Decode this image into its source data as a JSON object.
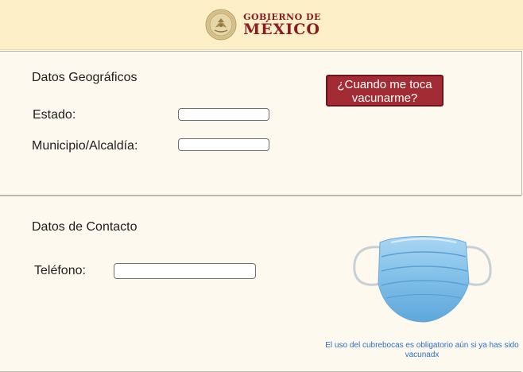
{
  "header": {
    "logo_line1": "GOBIERNO DE",
    "logo_line2": "MÉXICO",
    "brand_color": "#8b1a23"
  },
  "geo": {
    "title": "Datos Geográficos",
    "estado_label": "Estado:",
    "estado_value": "",
    "municipio_label": "Municipio/Alcaldía:",
    "municipio_value": "",
    "cta_label": "¿Cuando me toca vacunarme?"
  },
  "contact": {
    "title": "Datos de Contacto",
    "telefono_label": "Teléfono:",
    "telefono_value": "",
    "mask_note": "El uso del cubrebocas es obligatorio aún si ya has sido vacunadx"
  },
  "colors": {
    "background": "#fdf9ee",
    "header_bg": "#fdf0c8",
    "button_bg": "#a32c34",
    "note_text": "#2b6fc9"
  },
  "icons": [
    "coat-of-arms-icon",
    "face-mask-icon"
  ]
}
